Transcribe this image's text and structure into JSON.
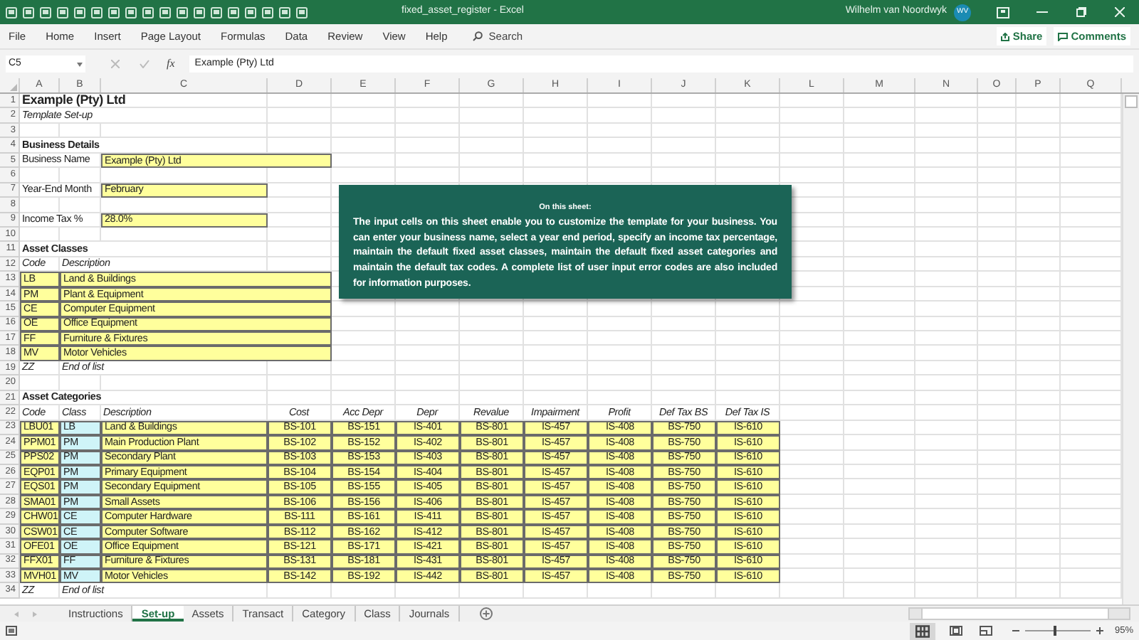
{
  "title_bar": {
    "title": "fixed_asset_register  -  Excel",
    "user": "Wilhelm van Noordwyk",
    "avatar": "WV"
  },
  "ribbon": {
    "tabs": [
      "File",
      "Home",
      "Insert",
      "Page Layout",
      "Formulas",
      "Data",
      "Review",
      "View",
      "Help"
    ],
    "search": "Search",
    "share": "Share",
    "comments": "Comments"
  },
  "formula_bar": {
    "name_box": "C5",
    "function_label": "fx",
    "value": "Example (Pty) Ltd"
  },
  "columns": [
    "A",
    "B",
    "C",
    "D",
    "E",
    "F",
    "G",
    "H",
    "I",
    "J",
    "K",
    "L",
    "M",
    "N",
    "O",
    "P",
    "Q"
  ],
  "rows": [
    {
      "number": "1",
      "kind": "title",
      "text": "Example (Pty) Ltd"
    },
    {
      "number": "2",
      "kind": "subtitle",
      "text": "Template Set-up"
    },
    {
      "number": "3",
      "kind": "blank"
    },
    {
      "number": "4",
      "kind": "heading",
      "text": "Business Details"
    },
    {
      "number": "5",
      "kind": "field_wide",
      "label": "Business Name",
      "value": "Example (Pty) Ltd"
    },
    {
      "number": "6",
      "kind": "blank"
    },
    {
      "number": "7",
      "kind": "field",
      "label": "Year-End Month",
      "value": "February"
    },
    {
      "number": "8",
      "kind": "blank"
    },
    {
      "number": "9",
      "kind": "field",
      "label": "Income Tax %",
      "value": "28.0%"
    },
    {
      "number": "10",
      "kind": "blank"
    },
    {
      "number": "11",
      "kind": "heading",
      "text": "Asset Classes"
    },
    {
      "number": "12",
      "kind": "class_header",
      "cells": [
        "Code",
        "Description"
      ]
    },
    {
      "number": "13",
      "kind": "class_row",
      "cells": [
        "LB",
        "Land & Buildings"
      ]
    },
    {
      "number": "14",
      "kind": "class_row",
      "cells": [
        "PM",
        "Plant & Equipment"
      ]
    },
    {
      "number": "15",
      "kind": "class_row",
      "cells": [
        "CE",
        "Computer Equipment"
      ]
    },
    {
      "number": "16",
      "kind": "class_row",
      "cells": [
        "OE",
        "Office Equipment"
      ]
    },
    {
      "number": "17",
      "kind": "class_row",
      "cells": [
        "FF",
        "Furniture & Fixtures"
      ]
    },
    {
      "number": "18",
      "kind": "class_row",
      "cells": [
        "MV",
        "Motor Vehicles"
      ]
    },
    {
      "number": "19",
      "kind": "end",
      "cells": [
        "ZZ",
        "End of list"
      ]
    },
    {
      "number": "20",
      "kind": "blank"
    },
    {
      "number": "21",
      "kind": "heading",
      "text": "Asset Categories"
    },
    {
      "number": "22",
      "kind": "category_header",
      "cells": [
        "Code",
        "Class",
        "Description",
        "Cost",
        "Acc Depr",
        "Depr",
        "Revalue",
        "Impairment",
        "Profit",
        "Def Tax BS",
        "Def Tax IS"
      ]
    },
    {
      "number": "23",
      "kind": "category_row",
      "cells": [
        "LBU01",
        "LB",
        "Land & Buildings",
        "BS-101",
        "BS-151",
        "IS-401",
        "BS-801",
        "IS-457",
        "IS-408",
        "BS-750",
        "IS-610"
      ]
    },
    {
      "number": "24",
      "kind": "category_row",
      "cells": [
        "PPM01",
        "PM",
        "Main Production Plant",
        "BS-102",
        "BS-152",
        "IS-402",
        "BS-801",
        "IS-457",
        "IS-408",
        "BS-750",
        "IS-610"
      ]
    },
    {
      "number": "25",
      "kind": "category_row",
      "cells": [
        "PPS02",
        "PM",
        "Secondary Plant",
        "BS-103",
        "BS-153",
        "IS-403",
        "BS-801",
        "IS-457",
        "IS-408",
        "BS-750",
        "IS-610"
      ]
    },
    {
      "number": "26",
      "kind": "category_row",
      "cells": [
        "EQP01",
        "PM",
        "Primary Equipment",
        "BS-104",
        "BS-154",
        "IS-404",
        "BS-801",
        "IS-457",
        "IS-408",
        "BS-750",
        "IS-610"
      ]
    },
    {
      "number": "27",
      "kind": "category_row",
      "cells": [
        "EQS01",
        "PM",
        "Secondary Equipment",
        "BS-105",
        "BS-155",
        "IS-405",
        "BS-801",
        "IS-457",
        "IS-408",
        "BS-750",
        "IS-610"
      ]
    },
    {
      "number": "28",
      "kind": "category_row",
      "cells": [
        "SMA01",
        "PM",
        "Small Assets",
        "BS-106",
        "BS-156",
        "IS-406",
        "BS-801",
        "IS-457",
        "IS-408",
        "BS-750",
        "IS-610"
      ]
    },
    {
      "number": "29",
      "kind": "category_row",
      "cells": [
        "CHW01",
        "CE",
        "Computer Hardware",
        "BS-111",
        "BS-161",
        "IS-411",
        "BS-801",
        "IS-457",
        "IS-408",
        "BS-750",
        "IS-610"
      ]
    },
    {
      "number": "30",
      "kind": "category_row",
      "cells": [
        "CSW01",
        "CE",
        "Computer Software",
        "BS-112",
        "BS-162",
        "IS-412",
        "BS-801",
        "IS-457",
        "IS-408",
        "BS-750",
        "IS-610"
      ]
    },
    {
      "number": "31",
      "kind": "category_row",
      "cells": [
        "OFE01",
        "OE",
        "Office Equipment",
        "BS-121",
        "BS-171",
        "IS-421",
        "BS-801",
        "IS-457",
        "IS-408",
        "BS-750",
        "IS-610"
      ]
    },
    {
      "number": "32",
      "kind": "category_row",
      "cells": [
        "FFX01",
        "FF",
        "Furniture & Fixtures",
        "BS-131",
        "BS-181",
        "IS-431",
        "BS-801",
        "IS-457",
        "IS-408",
        "BS-750",
        "IS-610"
      ]
    },
    {
      "number": "33",
      "kind": "category_row",
      "cells": [
        "MVH01",
        "MV",
        "Motor Vehicles",
        "BS-142",
        "BS-192",
        "IS-442",
        "BS-801",
        "IS-457",
        "IS-408",
        "BS-750",
        "IS-610"
      ]
    },
    {
      "number": "34",
      "kind": "end",
      "cells": [
        "ZZ",
        "End of list"
      ]
    }
  ],
  "note": {
    "heading": "On this sheet:",
    "body": "The input cells on this sheet enable you to customize the template for your business. You can enter your business name, select a year end period, specify an income tax percentage, maintain the default fixed asset classes, maintain the default fixed asset categories and maintain the default tax codes. A complete list of user input error codes are also included for information purposes."
  },
  "sheet_tabs": [
    {
      "label": "Instructions",
      "selected": false
    },
    {
      "label": "Set-up",
      "selected": true
    },
    {
      "label": "Assets",
      "selected": false
    },
    {
      "label": "Transact",
      "selected": false
    },
    {
      "label": "Category",
      "selected": false
    },
    {
      "label": "Class",
      "selected": false
    },
    {
      "label": "Journals",
      "selected": false
    }
  ],
  "status_bar": {
    "zoom": "95%",
    "zoom_slider": {
      "level": 0.45
    }
  }
}
